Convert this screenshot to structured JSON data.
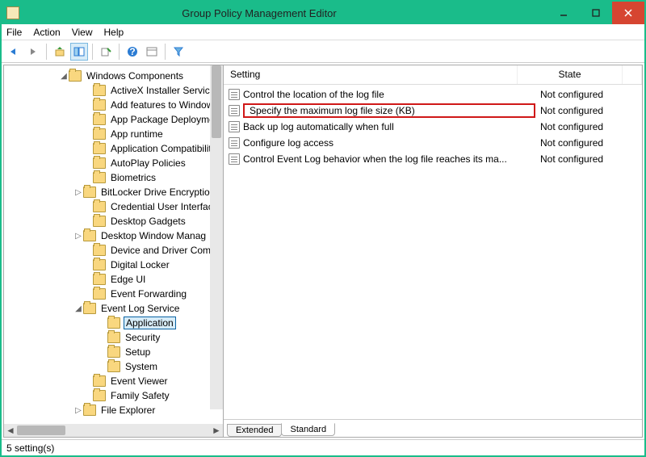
{
  "window": {
    "title": "Group Policy Management Editor"
  },
  "menu": {
    "file": "File",
    "action": "Action",
    "view": "View",
    "help": "Help"
  },
  "tree": {
    "root": {
      "label": "Windows Components",
      "indent": 80
    },
    "items": [
      {
        "label": "ActiveX Installer Service",
        "indent": 110
      },
      {
        "label": "Add features to Window",
        "indent": 110
      },
      {
        "label": "App Package Deploymen",
        "indent": 110
      },
      {
        "label": "App runtime",
        "indent": 110
      },
      {
        "label": "Application Compatibilit",
        "indent": 110
      },
      {
        "label": "AutoPlay Policies",
        "indent": 110
      },
      {
        "label": "Biometrics",
        "indent": 110
      },
      {
        "label": "BitLocker Drive Encryptio",
        "indent": 98,
        "expander": "▷"
      },
      {
        "label": "Credential User Interface",
        "indent": 110
      },
      {
        "label": "Desktop Gadgets",
        "indent": 110
      },
      {
        "label": "Desktop Window Manag",
        "indent": 98,
        "expander": "▷"
      },
      {
        "label": "Device and Driver Comp",
        "indent": 110
      },
      {
        "label": "Digital Locker",
        "indent": 110
      },
      {
        "label": "Edge UI",
        "indent": 110
      },
      {
        "label": "Event Forwarding",
        "indent": 110
      },
      {
        "label": "Event Log Service",
        "indent": 98,
        "expander": "◢"
      },
      {
        "label": "Application",
        "indent": 128,
        "selected": true
      },
      {
        "label": "Security",
        "indent": 128
      },
      {
        "label": "Setup",
        "indent": 128
      },
      {
        "label": "System",
        "indent": 128
      },
      {
        "label": "Event Viewer",
        "indent": 110
      },
      {
        "label": "Family Safety",
        "indent": 110
      },
      {
        "label": "File Explorer",
        "indent": 98,
        "expander": "▷"
      }
    ]
  },
  "list": {
    "columns": {
      "setting": "Setting",
      "state": "State"
    },
    "rows": [
      {
        "setting": "Control the location of the log file",
        "state": "Not configured"
      },
      {
        "setting": "Specify the maximum log file size (KB)",
        "state": "Not configured",
        "highlight": true
      },
      {
        "setting": "Back up log automatically when full",
        "state": "Not configured"
      },
      {
        "setting": "Configure log access",
        "state": "Not configured"
      },
      {
        "setting": "Control Event Log behavior when the log file reaches its ma...",
        "state": "Not configured"
      }
    ]
  },
  "tabs": {
    "extended": "Extended",
    "standard": "Standard"
  },
  "status": {
    "text": "5 setting(s)"
  }
}
